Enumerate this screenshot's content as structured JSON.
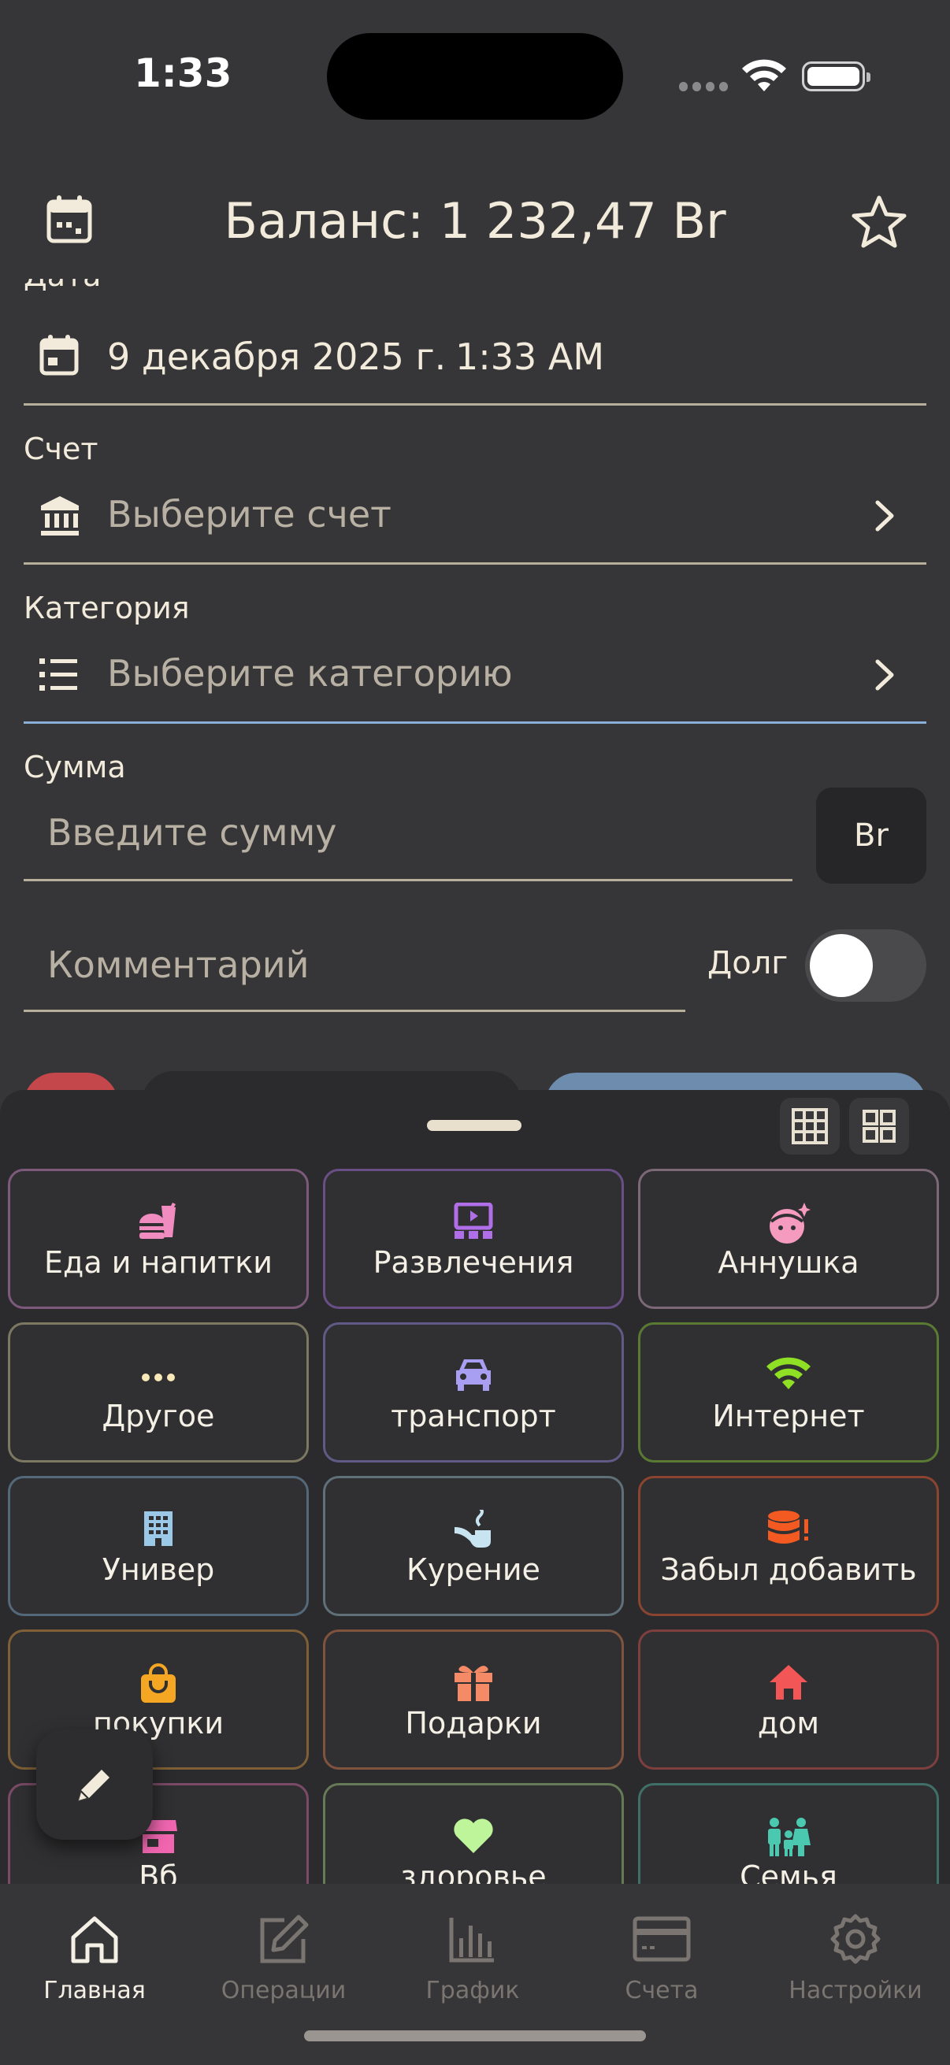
{
  "status_bar": {
    "time": "1:33"
  },
  "header": {
    "balance": "Баланс: 1 232,47 Br"
  },
  "form": {
    "date_label": "Дата",
    "date_value": "9 декабря 2025 г.",
    "time_value": "1:33 AM",
    "account_label": "Счет",
    "account_placeholder": "Выберите счет",
    "category_label": "Категория",
    "category_placeholder": "Выберите категорию",
    "amount_label": "Сумма",
    "amount_placeholder": "Введите сумму",
    "currency": "Br",
    "comment_placeholder": "Комментарий",
    "debt_label": "Долг",
    "debt_toggle_on": false
  },
  "colors": {
    "accent_line": "#8aaed6",
    "toggle_off": "#4a4a4c"
  },
  "categories": [
    {
      "label": "Еда и напитки",
      "icon": "fastfood-icon",
      "color": "#f08cc0",
      "border": "#7d5a7c"
    },
    {
      "label": "Развлечения",
      "icon": "movie-icon",
      "color": "#b06ee8",
      "border": "#6a4f86"
    },
    {
      "label": "Аннушка",
      "icon": "face-icon",
      "color": "#f59bc0",
      "border": "#7c6877"
    },
    {
      "label": "Другое",
      "icon": "more-icon",
      "color": "#f7e9b8",
      "border": "#7d7862"
    },
    {
      "label": "транспорт",
      "icon": "car-icon",
      "color": "#a89ef2",
      "border": "#5f5a86"
    },
    {
      "label": "Интернет",
      "icon": "wifi-icon",
      "color": "#8fe024",
      "border": "#5a7a34"
    },
    {
      "label": "Универ",
      "icon": "building-icon",
      "color": "#9cc8e8",
      "border": "#53697a"
    },
    {
      "label": "Курение",
      "icon": "pipe-icon",
      "color": "#c8e4f0",
      "border": "#5f7078"
    },
    {
      "label": "Забыл добавить",
      "icon": "database-alert-icon",
      "color": "#f35a22",
      "border": "#8a4430"
    },
    {
      "label": "покупки",
      "icon": "shopping-bag-icon",
      "color": "#f5a623",
      "border": "#7f6036"
    },
    {
      "label": "Подарки",
      "icon": "gift-icon",
      "color": "#f58a66",
      "border": "#80533f"
    },
    {
      "label": "дом",
      "icon": "home-icon",
      "color": "#f25656",
      "border": "#7e3f3f"
    },
    {
      "label": "Вб",
      "icon": "store-icon",
      "color": "#f066b0",
      "border": "#7a4a67"
    },
    {
      "label": "здоровье",
      "icon": "heart-icon",
      "color": "#bff59a",
      "border": "#657a57"
    },
    {
      "label": "Семья",
      "icon": "family-icon",
      "color": "#4ac8b0",
      "border": "#3f6f66"
    }
  ],
  "tabs": [
    {
      "label": "Главная",
      "icon": "home-icon",
      "active": true
    },
    {
      "label": "Операции",
      "icon": "edit-icon",
      "active": false
    },
    {
      "label": "График",
      "icon": "bar-chart-icon",
      "active": false
    },
    {
      "label": "Счета",
      "icon": "card-icon",
      "active": false
    },
    {
      "label": "Настройки",
      "icon": "settings-icon",
      "active": false
    }
  ]
}
